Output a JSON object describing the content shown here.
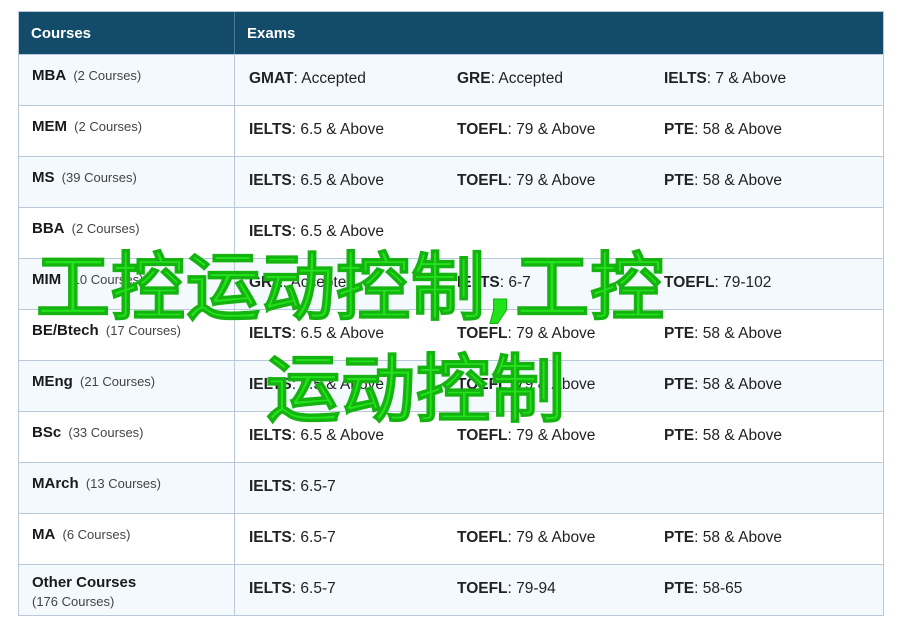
{
  "header": {
    "courses": "Courses",
    "exams": "Exams"
  },
  "rows": [
    {
      "name": "MBA",
      "count": "(2 Courses)",
      "exams": [
        {
          "label": "GMAT",
          "value": ": Accepted"
        },
        {
          "label": "GRE",
          "value": ": Accepted"
        },
        {
          "label": "IELTS",
          "value": ": 7 & Above"
        }
      ]
    },
    {
      "name": "MEM",
      "count": "(2 Courses)",
      "exams": [
        {
          "label": "IELTS",
          "value": ": 6.5 & Above"
        },
        {
          "label": "TOEFL",
          "value": ": 79 & Above"
        },
        {
          "label": "PTE",
          "value": ": 58 & Above"
        }
      ]
    },
    {
      "name": "MS",
      "count": "(39 Courses)",
      "exams": [
        {
          "label": "IELTS",
          "value": ": 6.5 & Above"
        },
        {
          "label": "TOEFL",
          "value": ": 79 & Above"
        },
        {
          "label": "PTE",
          "value": ": 58 & Above"
        }
      ]
    },
    {
      "name": "BBA",
      "count": "(2 Courses)",
      "exams": [
        {
          "label": "IELTS",
          "value": ": 6.5 & Above"
        },
        {
          "label": "",
          "value": ""
        },
        {
          "label": "",
          "value": ""
        }
      ]
    },
    {
      "name": "MIM",
      "count": "(10 Courses)",
      "exams": [
        {
          "label": "GRE",
          "value": ": Accepted"
        },
        {
          "label": "IELTS",
          "value": ": 6-7"
        },
        {
          "label": "TOEFL",
          "value": ": 79-102"
        }
      ]
    },
    {
      "name": "BE/Btech",
      "count": "(17 Courses)",
      "exams": [
        {
          "label": "IELTS",
          "value": ": 6.5 & Above"
        },
        {
          "label": "TOEFL",
          "value": ": 79 & Above"
        },
        {
          "label": "PTE",
          "value": ": 58 & Above"
        }
      ]
    },
    {
      "name": "MEng",
      "count": "(21 Courses)",
      "exams": [
        {
          "label": "IELTS",
          "value": ": 6.5 & Above"
        },
        {
          "label": "TOEFL",
          "value": ": 79 & Above"
        },
        {
          "label": "PTE",
          "value": ": 58 & Above"
        }
      ]
    },
    {
      "name": "BSc",
      "count": "(33 Courses)",
      "exams": [
        {
          "label": "IELTS",
          "value": ": 6.5 & Above"
        },
        {
          "label": "TOEFL",
          "value": ": 79 & Above"
        },
        {
          "label": "PTE",
          "value": ": 58 & Above"
        }
      ]
    },
    {
      "name": "MArch",
      "count": "(13 Courses)",
      "exams": [
        {
          "label": "IELTS",
          "value": ": 6.5-7"
        },
        {
          "label": "",
          "value": ""
        },
        {
          "label": "",
          "value": ""
        }
      ]
    },
    {
      "name": "MA",
      "count": "(6 Courses)",
      "exams": [
        {
          "label": "IELTS",
          "value": ": 6.5-7"
        },
        {
          "label": "TOEFL",
          "value": ": 79 & Above"
        },
        {
          "label": "PTE",
          "value": ": 58 & Above"
        }
      ]
    },
    {
      "name": "Other Courses",
      "count": "(176 Courses)",
      "exams": [
        {
          "label": "IELTS",
          "value": ": 6.5-7"
        },
        {
          "label": "TOEFL",
          "value": ": 79-94"
        },
        {
          "label": "PTE",
          "value": ": 58-65"
        }
      ]
    }
  ],
  "watermark": {
    "line1": "工控运动控制,工控",
    "line2": "运动控制"
  },
  "colors": {
    "header_bg": "#134b6b",
    "border": "#b9c9d9",
    "alt_row": "#f3f9fd",
    "watermark": "#22e21b"
  }
}
